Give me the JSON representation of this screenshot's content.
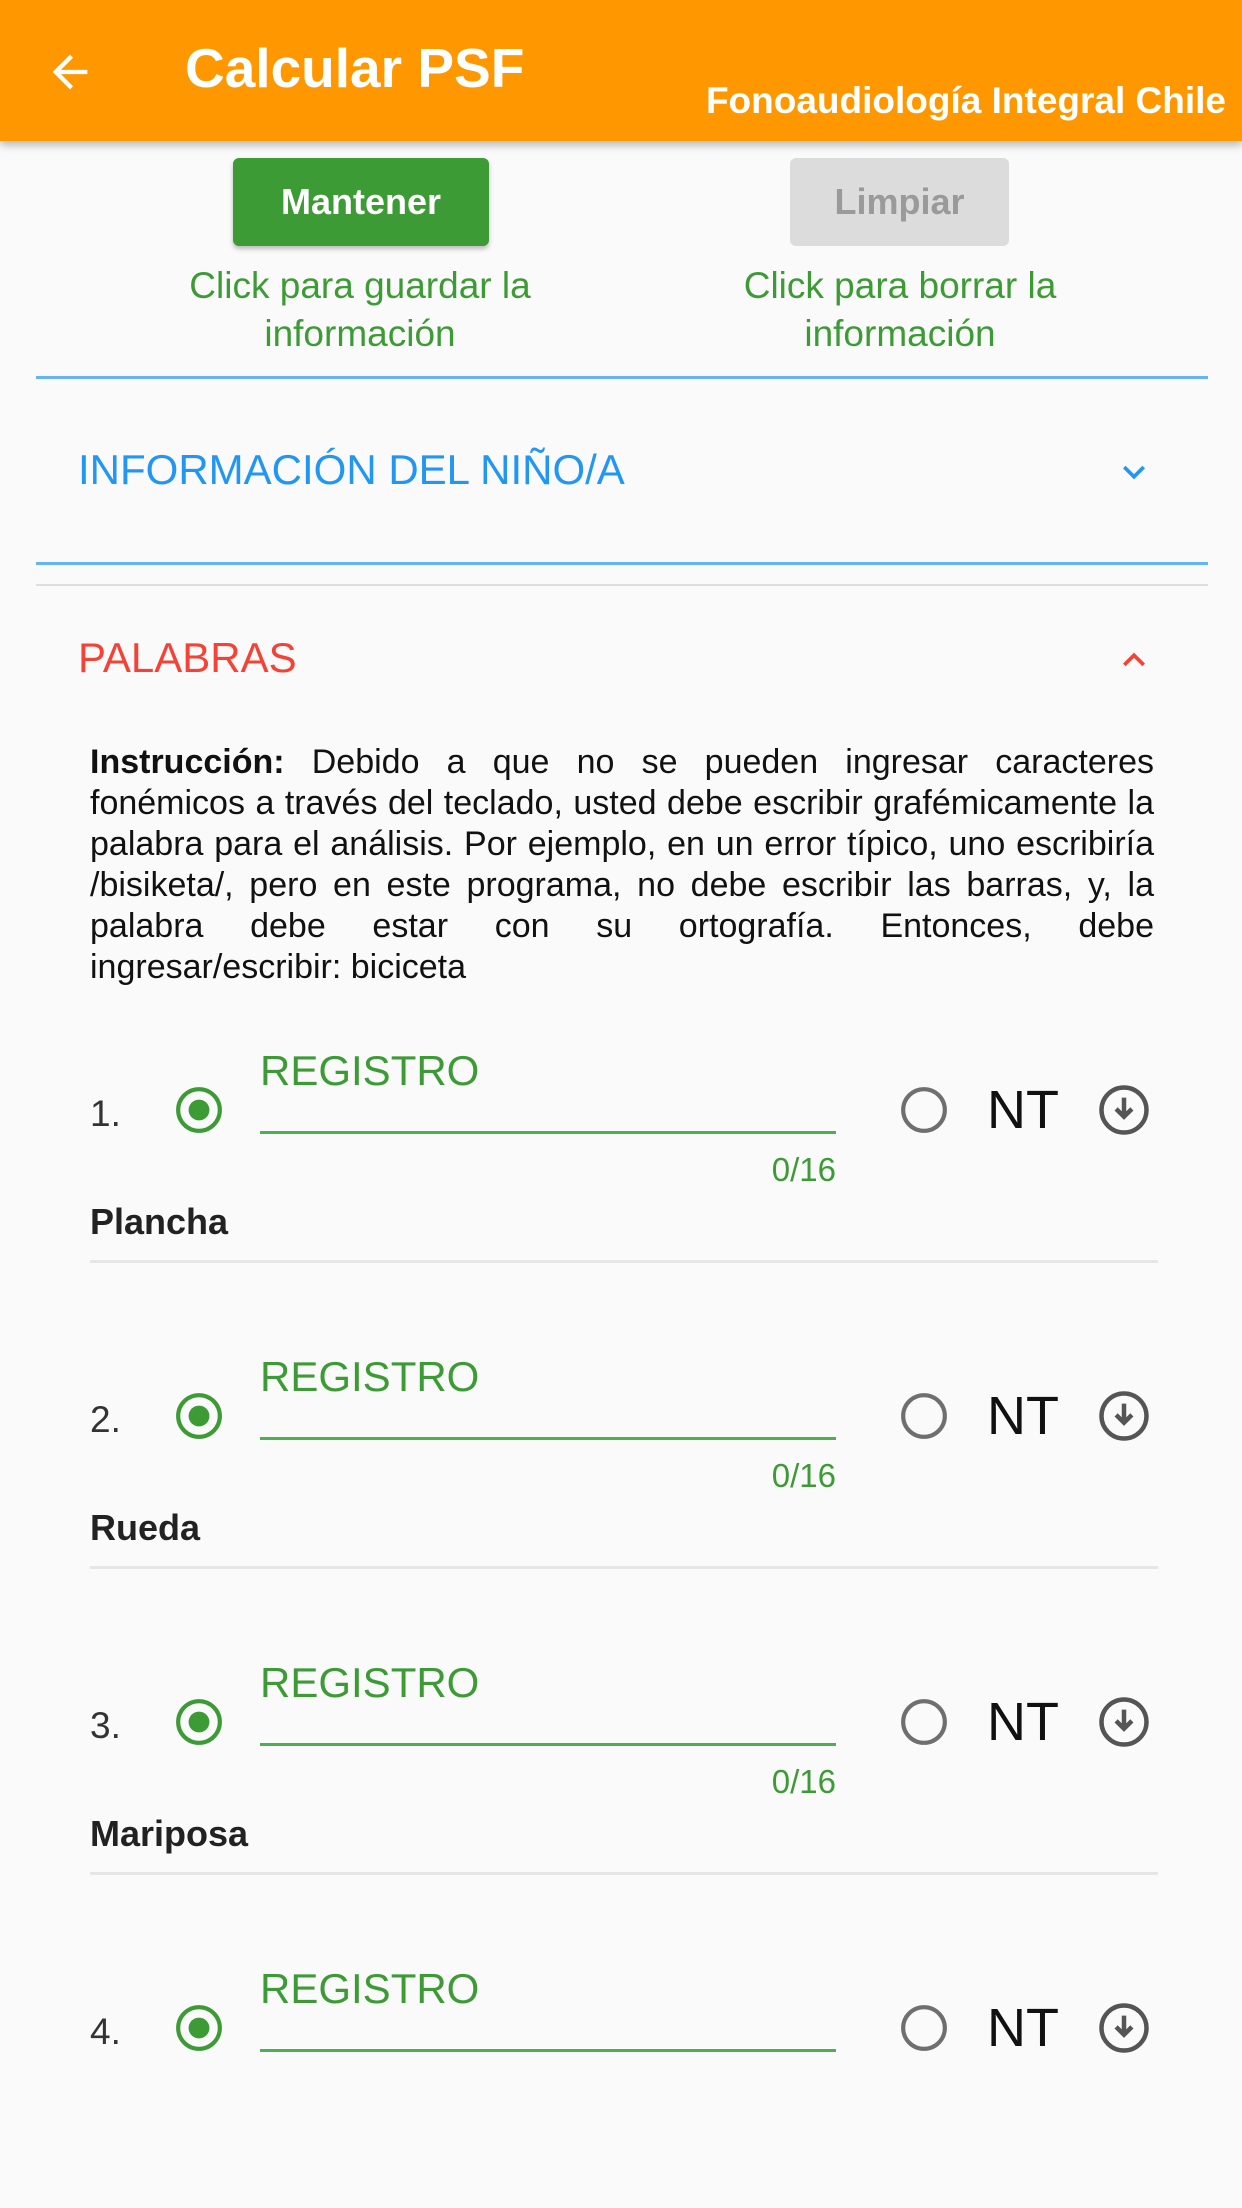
{
  "appbar": {
    "title": "Calcular PSF",
    "subtitle": "Fonoaudiología Integral Chile",
    "color": "#ff9800",
    "back_icon": "arrow-left-icon"
  },
  "actions": {
    "save_label": "Mantener",
    "save_hint": "Click para guardar la\ninformación",
    "clear_label": "Limpiar",
    "clear_hint": "Click para borrar la\ninformación"
  },
  "sections": {
    "info": {
      "title": "INFORMACIÓN DEL NIÑO/A",
      "expanded": false,
      "color": "#2196f3"
    },
    "words": {
      "title": "PALABRAS",
      "expanded": true,
      "color": "#f44336"
    }
  },
  "instruction": {
    "label": "Instrucción:",
    "text": "Debido a que no se pueden ingresar caracteres fonémicos a través del teclado, usted debe escribir grafémicamente la palabra para el análisis. Por ejemplo, en un error típico, uno escribiría /bisiketa/, pero en este programa, no debe escribir las barras, y, la palabra debe estar con su ortografía. Entonces, debe ingresar/escribir: biciceta"
  },
  "items": [
    {
      "number": "1.",
      "field_label": "REGISTRO",
      "counter": "0/16",
      "nt_label": "NT",
      "word": "Plancha"
    },
    {
      "number": "2.",
      "field_label": "REGISTRO",
      "counter": "0/16",
      "nt_label": "NT",
      "word": "Rueda"
    },
    {
      "number": "3.",
      "field_label": "REGISTRO",
      "counter": "0/16",
      "nt_label": "NT",
      "word": "Mariposa"
    },
    {
      "number": "4.",
      "field_label": "REGISTRO",
      "counter": "",
      "nt_label": "NT",
      "word": ""
    }
  ],
  "colors": {
    "green": "#3d9b35",
    "blue_line": "#64b5f6"
  }
}
